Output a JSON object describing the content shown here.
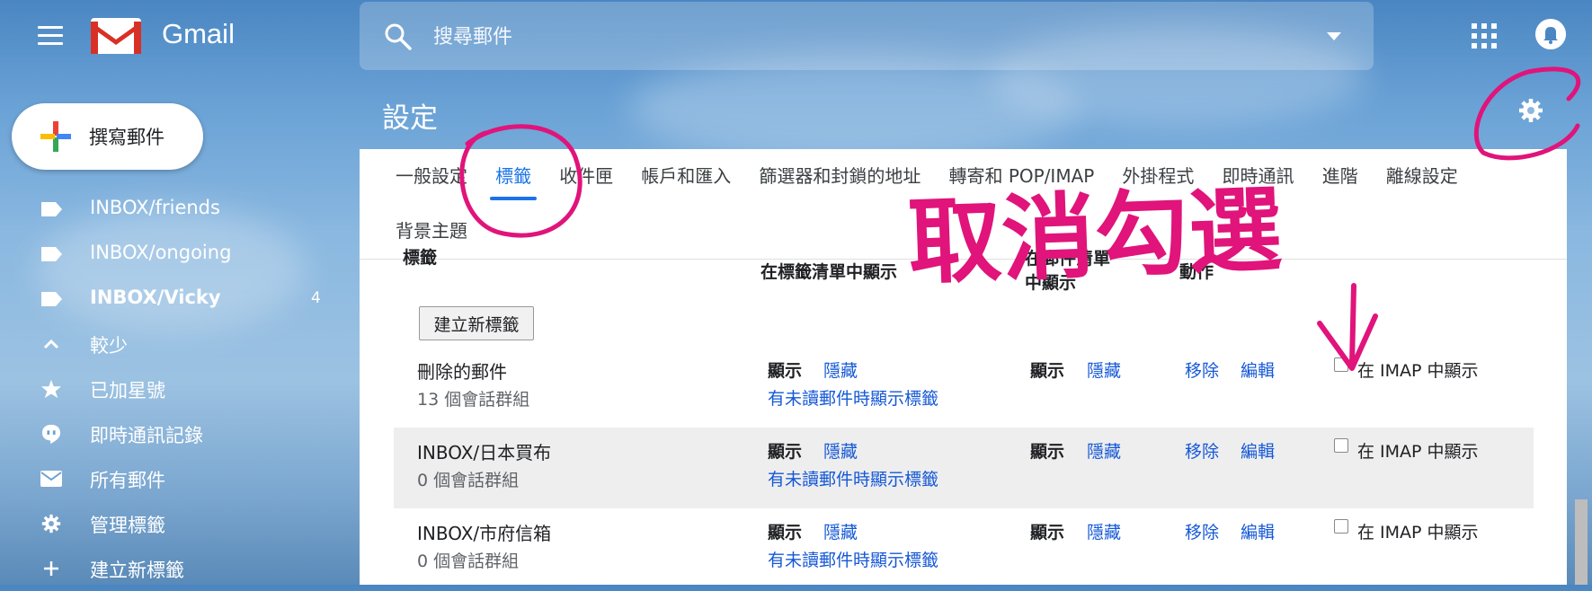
{
  "app": {
    "name": "Gmail"
  },
  "search": {
    "placeholder": "搜尋郵件"
  },
  "sidebar": {
    "compose_label": "撰寫郵件",
    "items": [
      {
        "label": "INBOX/friends",
        "icon": "label-icon",
        "count": ""
      },
      {
        "label": "INBOX/ongoing",
        "icon": "label-icon",
        "count": ""
      },
      {
        "label": "INBOX/Vicky",
        "icon": "label-icon",
        "count": "4"
      },
      {
        "label": "較少",
        "icon": "chevron-up-icon",
        "count": ""
      },
      {
        "label": "已加星號",
        "icon": "star-icon",
        "count": ""
      },
      {
        "label": "即時通訊記錄",
        "icon": "chat-icon",
        "count": ""
      },
      {
        "label": "所有郵件",
        "icon": "mail-icon",
        "count": ""
      },
      {
        "label": "管理標籤",
        "icon": "gear-icon",
        "count": ""
      },
      {
        "label": "建立新標籤",
        "icon": "plus-icon",
        "count": ""
      }
    ]
  },
  "settings": {
    "title": "設定",
    "tabs": [
      "一般設定",
      "標籤",
      "收件匣",
      "帳戶和匯入",
      "篩選器和封鎖的地址",
      "轉寄和 POP/IMAP",
      "外掛程式",
      "即時通訊",
      "進階",
      "離線設定"
    ],
    "tabs_row2": "背景主題",
    "active_tab": "標籤",
    "columns": {
      "label": "標籤",
      "show_in_label_list": "在標籤清單中顯示",
      "show_in_message_list_1": "在郵件清單",
      "show_in_message_list_2": "中顯示",
      "actions": "動作"
    },
    "create_label_button": "建立新標籤",
    "rows": [
      {
        "name": "刪除的郵件",
        "count": "13 個會話群組",
        "show": "顯示",
        "hide": "隱藏",
        "unread": "有未讀郵件時顯示標籤",
        "show2": "顯示",
        "hide2": "隱藏",
        "remove": "移除",
        "edit": "編輯",
        "imap": "在 IMAP 中顯示"
      },
      {
        "name": "INBOX/日本買布",
        "count": "0 個會話群組",
        "show": "顯示",
        "hide": "隱藏",
        "unread": "有未讀郵件時顯示標籤",
        "show2": "顯示",
        "hide2": "隱藏",
        "remove": "移除",
        "edit": "編輯",
        "imap": "在 IMAP 中顯示"
      },
      {
        "name": "INBOX/市府信箱",
        "count": "0 個會話群組",
        "show": "顯示",
        "hide": "隱藏",
        "unread": "有未讀郵件時顯示標籤",
        "show2": "顯示",
        "hide2": "隱藏",
        "remove": "移除",
        "edit": "編輯",
        "imap": "在 IMAP 中顯示"
      }
    ]
  },
  "annotation": {
    "text": "取消勾選",
    "color": "#e0147a"
  },
  "colors": {
    "active_tab": "#1a73e8",
    "link": "#1558d6"
  }
}
